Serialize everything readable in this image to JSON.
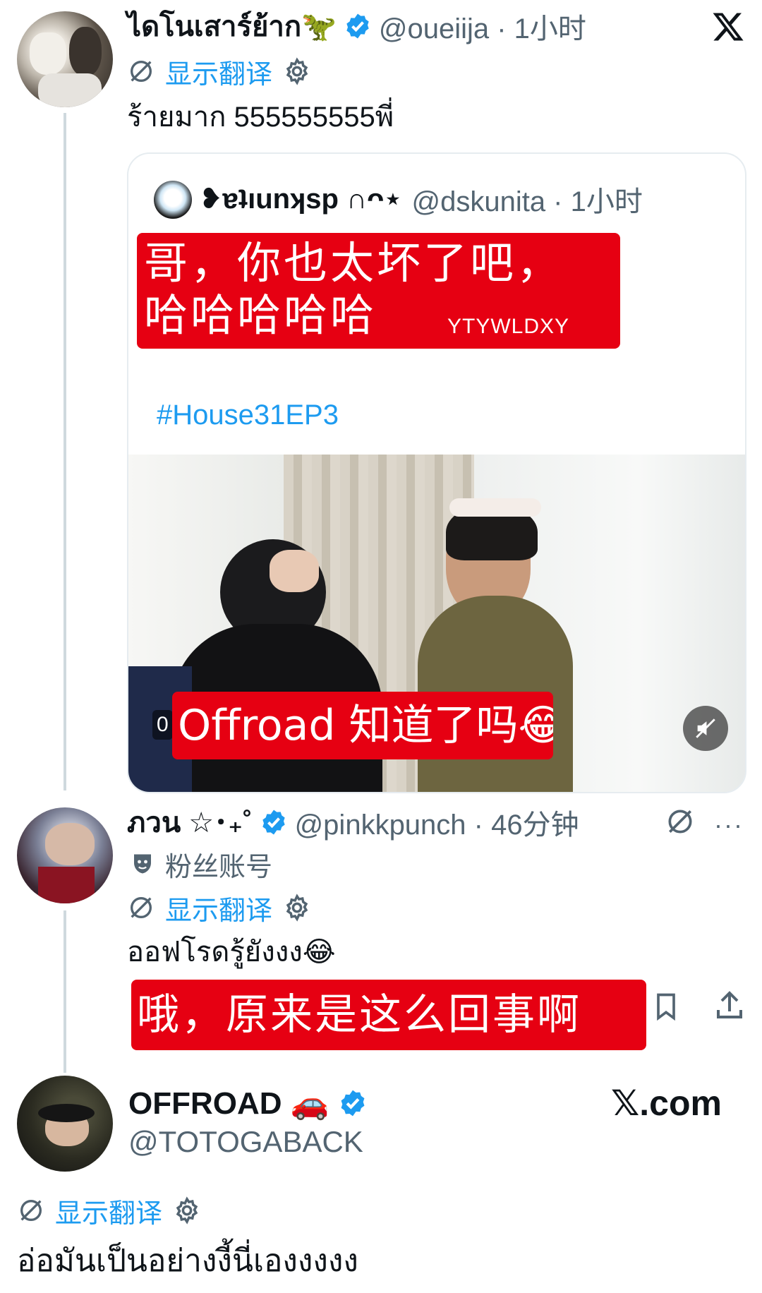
{
  "tweet1": {
    "display_name": "ไดโนเสาร์ย้าก🦖",
    "handle_time": "@oueiija · 1小时",
    "translate_label": "显示翻译",
    "text": "ร้ายมาก 555555555พี่"
  },
  "quote": {
    "display_name": "❥ɐʇıunʞsp ∩ᴖ⋆",
    "handle_time": "@dskunita · 1小时",
    "overlay_text": "哥，你也太坏了吧，哈哈哈哈哈",
    "watermark": "YTYWLDXY",
    "hashtag": "#House31EP3",
    "video_timer_prefix": "0",
    "video_subtitle": "Offroad 知道了吗😂"
  },
  "tweet2": {
    "display_name": "ภวน ☆･₊˚",
    "handle_time": "@pinkkpunch · 46分钟",
    "fan_label": "粉丝账号",
    "translate_label": "显示翻译",
    "text": "ออฟโรดรู้ยังงง😂",
    "overlay_text": "哦，原来是这么回事啊"
  },
  "tweet3": {
    "display_name": "OFFROAD 🚗",
    "handle": "@TOTOGABACK",
    "site_label": "𝕏.com",
    "translate_label": "显示翻译",
    "text": "อ่อมันเป็นอย่างงี้นี่เองงงงง"
  },
  "colors": {
    "accent": "#1d9bf0",
    "overlay_red": "#e60012",
    "text_grey": "#536471"
  }
}
